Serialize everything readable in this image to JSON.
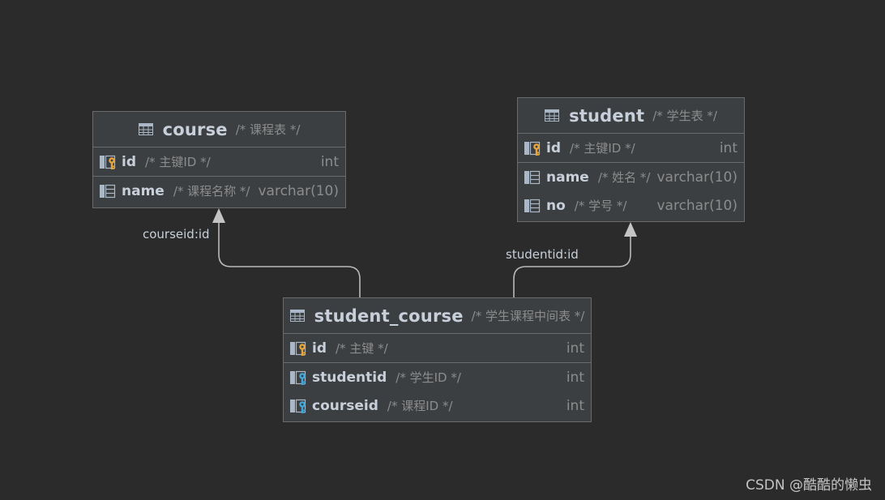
{
  "tables": {
    "course": {
      "name": "course",
      "comment": "/* 课程表 */",
      "columns": [
        {
          "name": "id",
          "comment": "/* 主键ID */",
          "type": "int",
          "key": "primary"
        },
        {
          "name": "name",
          "comment": "/* 课程名称 */",
          "type": "varchar(10)",
          "key": "none"
        }
      ]
    },
    "student": {
      "name": "student",
      "comment": "/* 学生表 */",
      "columns": [
        {
          "name": "id",
          "comment": "/* 主键ID */",
          "type": "int",
          "key": "primary"
        },
        {
          "name": "name",
          "comment": "/* 姓名 */",
          "type": "varchar(10)",
          "key": "none"
        },
        {
          "name": "no",
          "comment": "/* 学号 */",
          "type": "varchar(10)",
          "key": "none"
        }
      ]
    },
    "student_course": {
      "name": "student_course",
      "comment": "/* 学生课程中间表 */",
      "columns": [
        {
          "name": "id",
          "comment": "/* 主键 */",
          "type": "int",
          "key": "primary"
        },
        {
          "name": "studentid",
          "comment": "/* 学生ID */",
          "type": "int",
          "key": "foreign"
        },
        {
          "name": "courseid",
          "comment": "/* 课程ID */",
          "type": "int",
          "key": "foreign"
        }
      ]
    }
  },
  "relations": {
    "to_course": {
      "label": "courseid:id",
      "from": "student_course",
      "to": "course"
    },
    "to_student": {
      "label": "studentid:id",
      "from": "student_course",
      "to": "student"
    }
  },
  "icons": {
    "table": "table-icon",
    "primary_key": "primary-key-column-icon",
    "foreign_key": "foreign-key-column-icon",
    "column": "column-icon"
  },
  "colors": {
    "background": "#2b2b2b",
    "table_fill": "#3c3f41",
    "primary_key": "#e8a53c",
    "foreign_key": "#41a6d9"
  },
  "watermark": "CSDN @酷酷的懒虫"
}
